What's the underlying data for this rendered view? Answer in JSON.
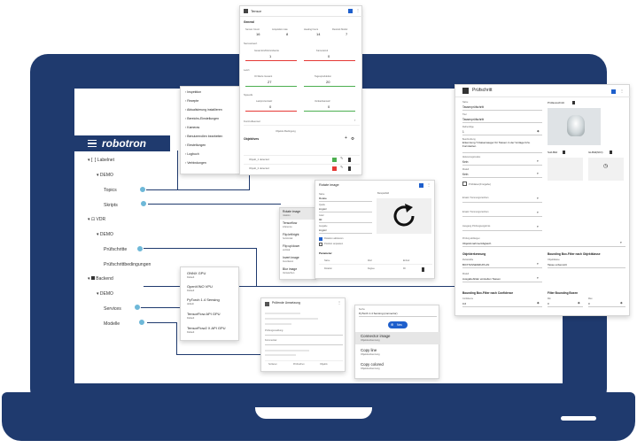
{
  "brand": "robotron",
  "tree": [
    {
      "label": "Labelnet",
      "type": "bracket"
    },
    {
      "label": "DEMO"
    },
    {
      "label": "Topics"
    },
    {
      "label": "Skripts"
    },
    {
      "label": "VDR",
      "type": "square"
    },
    {
      "label": "DEMO"
    },
    {
      "label": "Prüfschritte"
    },
    {
      "label": "Prüfschrittbedingungen"
    },
    {
      "label": "Backend",
      "type": "square"
    },
    {
      "label": "DEMO"
    },
    {
      "label": "Services"
    },
    {
      "label": "Modelle"
    }
  ],
  "menu": {
    "items": [
      "Inspektion",
      "Rezepte",
      "Aktualisierung installieren",
      "Bereichs-Einstellungen",
      "Kameras",
      "Benutzerrollen bearbeiten",
      "Einstellungen",
      "Logbuch",
      "Verbindungen"
    ]
  },
  "sensor": {
    "title": "Tensor",
    "section_general": "General",
    "stats_labels": [
      "Sensor Count",
      "Acquisition rate",
      "Heating hours",
      "Restzeit Modul"
    ],
    "stats_values": [
      "16",
      "8",
      "14",
      "7"
    ],
    "section_values": "Sensorwert",
    "k1_label": "Gesamtzahl Einzelwerte",
    "k1_value": "1",
    "k2_label": "Kamerazeit",
    "k2_value": "0",
    "section_last": "Letzt",
    "k3_label": "IO-Werte Gesamt",
    "k3_value": "27",
    "k4_label": "Tagesproduktion",
    "k4_value": "20",
    "section_speed": "Speeds",
    "k5_label": "Lastprozentsatz",
    "k5_value": "0",
    "k6_label": "Verkaufsansatz",
    "k6_value": "0",
    "section_control": "Kontrollsensor",
    "objectives_label": "Objektiv-Bedingung",
    "objectives": "Objektives",
    "row1": "Objekt_1 detected",
    "row2": "Objekt_2 detected"
  },
  "rotate": {
    "title": "Rotate image",
    "field1_label": "Name",
    "field1_value": "Rotate",
    "field2_label": "Quelle",
    "field2_value": "imgsrc",
    "field3_label": "Grad",
    "field3_value": "90",
    "field4_label": "Ausgabe",
    "field4_value": "imgsrc",
    "preview_label": "Beispielbild",
    "check1": "Rotation aktivieren",
    "check2": "Position anpassen",
    "params_label": "Parameter",
    "col_headers": [
      "Name",
      "Wert",
      "Einheit"
    ],
    "param_row": [
      "Rotation",
      "Degree",
      "90"
    ]
  },
  "options": [
    {
      "title": "Rotate image",
      "sub": "rotation"
    },
    {
      "title": "Tensorflow",
      "sub": "inference"
    },
    {
      "title": "Flip left/right",
      "sub": "horizontal"
    },
    {
      "title": "Flip up/down",
      "sub": "vertical"
    },
    {
      "title": "Invert image",
      "sub": "Invertieren"
    },
    {
      "title": "Blur image",
      "sub": "Verwischen"
    }
  ],
  "models": [
    {
      "title": "ONNX GPU",
      "sub": "Default"
    },
    {
      "title": "OpenVINO VPU",
      "sub": "Default"
    },
    {
      "title": "PyTorch 1.4 Sensing",
      "sub": "default"
    },
    {
      "title": "TensorFlow API GPU",
      "sub": "Default"
    },
    {
      "title": "TensorFlow2 X API GPU",
      "sub": "Default"
    }
  ],
  "condition": {
    "title": "Prüfende Umsetzung",
    "field1": "Prüfungsmeldung",
    "field2": "Kommentar",
    "footer": [
      "Sortieren",
      "Prüfzeichen",
      "Objektiv"
    ]
  },
  "connector": {
    "header_label": "Suche",
    "header_value": "PyTorch 1.4 Sensing (connector)",
    "button": "Neu",
    "items": [
      {
        "title": "Connector image",
        "sub": "Objektiverkennung",
        "selected": true
      },
      {
        "title": "Copy line",
        "sub": "Objektiverkennung",
        "selected": false
      },
      {
        "title": "Copy colored",
        "sub": "Objektiverkennung",
        "selected": false
      }
    ]
  },
  "pruef": {
    "title": "Prüfschritt",
    "fields": [
      {
        "label": "Name",
        "value": "Tassenprüfschritt"
      },
      {
        "label": "Titel",
        "value": "Tassenprüfschritt"
      },
      {
        "label": "Reihenfolge",
        "value": "1"
      },
      {
        "label": "Beschreibung",
        "value": "Erkennung T-Kaisersauger für Tassen in der Vorlage bzw. Formkarten"
      },
      {
        "label": "Aktivierungsmodus",
        "value": "Kein"
      },
      {
        "label": "Modell",
        "value": "Kein"
      }
    ],
    "check_label": "Prüfdaten(Freigabe)",
    "selects": [
      "Ersatz-Trennungszeichen",
      "Ersatz-Trennungszeichen",
      "Ausgang Prüfungsergebnis"
    ],
    "select_label": "Prüfung abhängen",
    "select_value": "Objektivnahme/Abgleich",
    "preview_label": "Prüfausschnitt",
    "img2_label": "Soll-Bild",
    "img3_label": "Ist-Bild(NIO)",
    "section_obj": "Objekterkennung",
    "obj_label": "Zielvariable",
    "obj_value": "BOXTASSENRUPLAN",
    "obj2_label": "Modell",
    "obj2_value": "Ausgabebilder einstellen Tassen",
    "section_thr": "Bounding Box-Filter nach Objektklasse",
    "thr_label": "Objektklasse",
    "thr_value": "Tasse unbenutzt",
    "section_conf": "Bounding Box-Filter nach Confidence",
    "conf_label": "Confidence",
    "conf_value": "0,6",
    "section_size": "Filter Bounding Boxen",
    "size_label1": "Min",
    "size_val1": "0",
    "size_label2": "Max",
    "size_val2": "0"
  },
  "colors": {
    "laptop": "#1f3a6e",
    "accent": "#1e5fcc",
    "dot": "#6eb8d8",
    "green": "#4caf50",
    "red": "#e53935"
  }
}
